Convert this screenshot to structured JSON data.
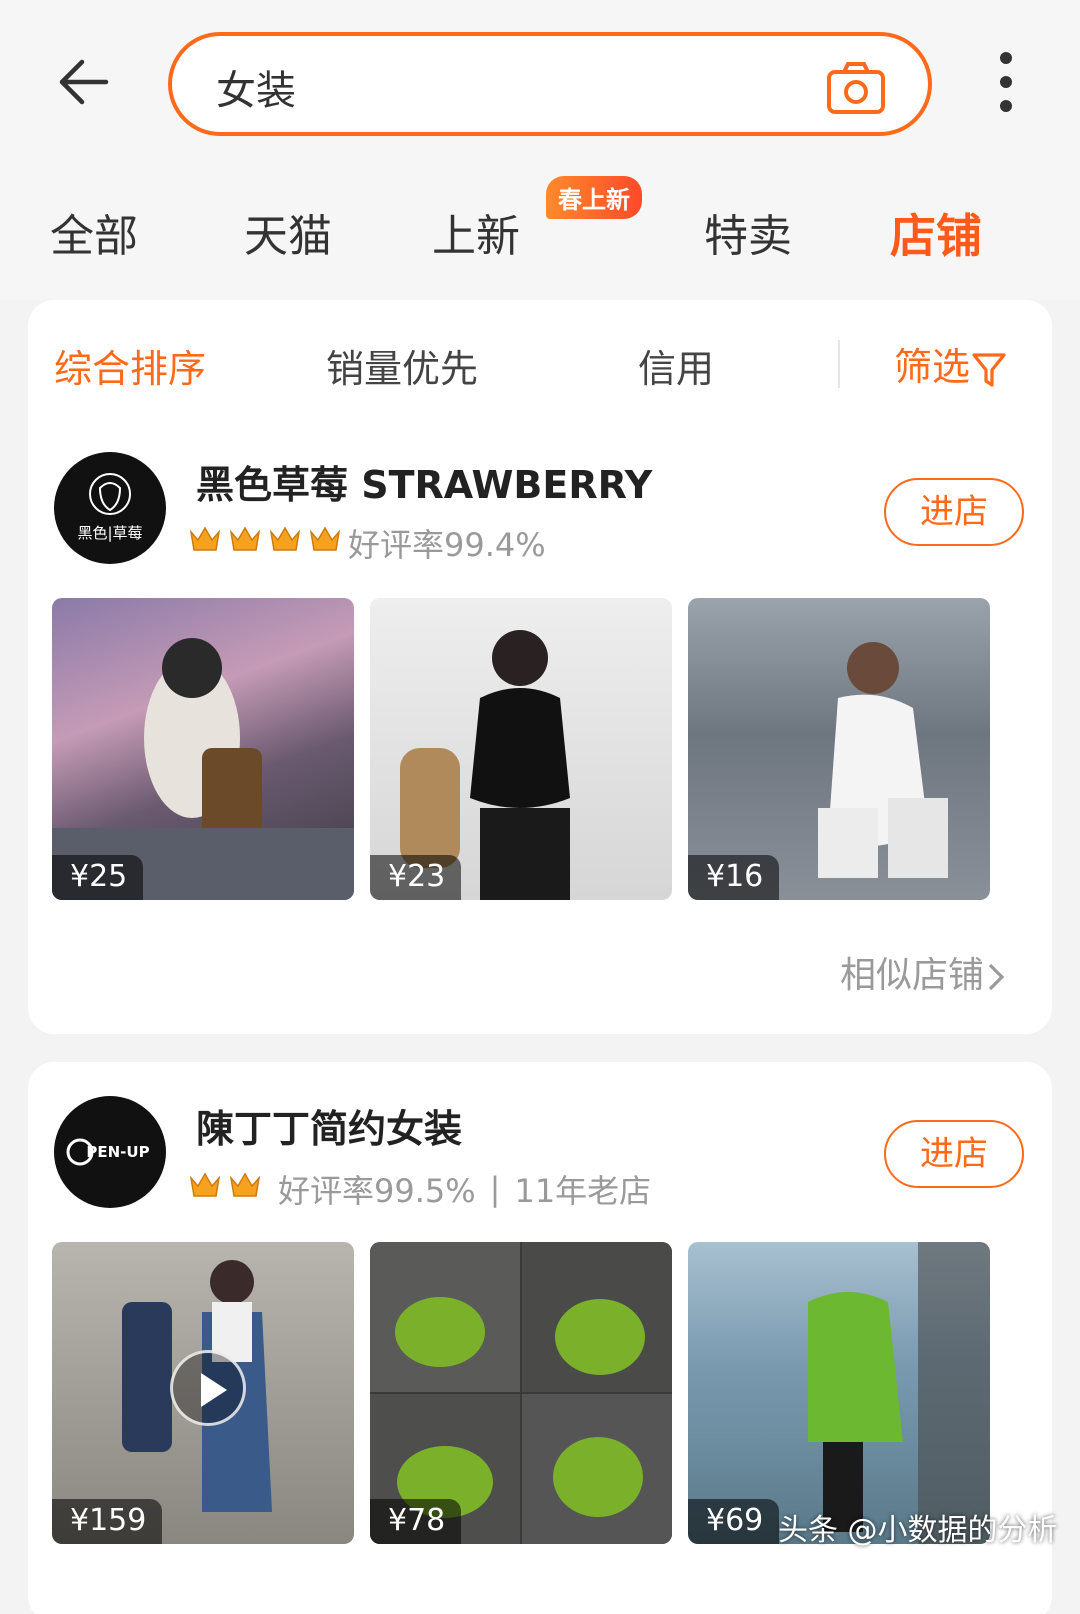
{
  "search": {
    "query": "女装"
  },
  "tabs": [
    {
      "label": "全部"
    },
    {
      "label": "天猫"
    },
    {
      "label": "上新",
      "badge": "春上新"
    },
    {
      "label": "特卖"
    },
    {
      "label": "店铺",
      "active": true
    }
  ],
  "sort": {
    "options": [
      "综合排序",
      "销量优先",
      "信用"
    ],
    "filter_label": "筛选"
  },
  "shops": [
    {
      "name": "黑色草莓  STRAWBERRY",
      "logo_text": "黑色|草莓",
      "crowns": 4,
      "rating": "好评率99.4%",
      "age": "",
      "enter_label": "进店",
      "products": [
        {
          "price": "¥25"
        },
        {
          "price": "¥23"
        },
        {
          "price": "¥16"
        }
      ],
      "similar_label": "相似店铺"
    },
    {
      "name": "陳丁丁简约女装",
      "logo_text": "PEN-UP",
      "crowns": 2,
      "rating": "好评率99.5%",
      "age": "11年老店",
      "enter_label": "进店",
      "products": [
        {
          "price": "¥159"
        },
        {
          "price": "¥78"
        },
        {
          "price": "¥69"
        }
      ]
    }
  ],
  "watermark": "头条 @小数据的分析",
  "colors": {
    "accent": "#ff6a1a",
    "crown": "#f6a21e"
  }
}
